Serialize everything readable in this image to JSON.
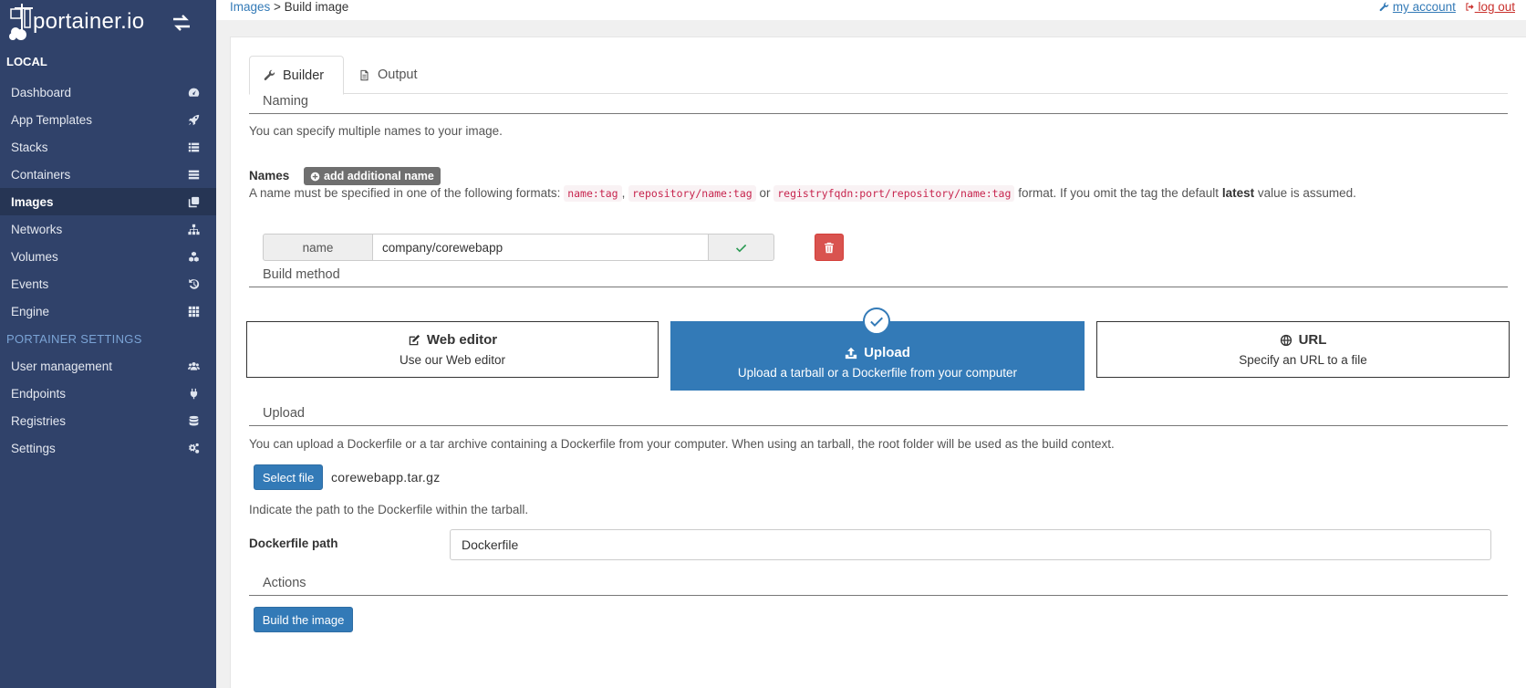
{
  "sidebar": {
    "brand": "portainer.io",
    "section_local": "LOCAL",
    "items": [
      {
        "label": "Dashboard",
        "icon": "tachometer-icon"
      },
      {
        "label": "App Templates",
        "icon": "rocket-icon"
      },
      {
        "label": "Stacks",
        "icon": "th-list-icon"
      },
      {
        "label": "Containers",
        "icon": "server-icon"
      },
      {
        "label": "Images",
        "icon": "clone-icon",
        "active": true
      },
      {
        "label": "Networks",
        "icon": "sitemap-icon"
      },
      {
        "label": "Volumes",
        "icon": "cubes-icon"
      },
      {
        "label": "Events",
        "icon": "history-icon"
      },
      {
        "label": "Engine",
        "icon": "th-icon"
      }
    ],
    "section_settings": "PORTAINER SETTINGS",
    "settings_items": [
      {
        "label": "User management",
        "icon": "users-icon"
      },
      {
        "label": "Endpoints",
        "icon": "plug-icon"
      },
      {
        "label": "Registries",
        "icon": "database-icon"
      },
      {
        "label": "Settings",
        "icon": "cogs-icon"
      }
    ]
  },
  "topbar": {
    "breadcrumb_link": "Images",
    "breadcrumb_current": "> Build image",
    "my_account": "my account",
    "log_out": "log out"
  },
  "tabs": {
    "builder": "Builder",
    "output": "Output"
  },
  "naming": {
    "title": "Naming",
    "help": "You can specify multiple names to your image.",
    "names_label": "Names",
    "add_button": "add additional name",
    "format_prefix": "A name must be specified in one of the following formats:",
    "format_1": "name:tag",
    "format_sep1": ",",
    "format_2": "repository/name:tag",
    "format_or": "or",
    "format_3": "registryfqdn:port/repository/name:tag",
    "format_suffix": "format. If you omit the tag the default",
    "format_latest": "latest",
    "format_end": "value is assumed.",
    "name_addon": "name",
    "name_value": "company/corewebapp"
  },
  "build_method": {
    "title": "Build method",
    "web_editor_title": "Web editor",
    "web_editor_desc": "Use our Web editor",
    "upload_title": "Upload",
    "upload_desc": "Upload a tarball or a Dockerfile from your computer",
    "url_title": "URL",
    "url_desc": "Specify an URL to a file",
    "selected": "upload"
  },
  "upload": {
    "title": "Upload",
    "help": "You can upload a Dockerfile or a tar archive containing a Dockerfile from your computer. When using an tarball, the root folder will be used as the build context.",
    "select_button": "Select file",
    "file_name": "corewebapp.tar.gz",
    "path_help": "Indicate the path to the Dockerfile within the tarball.",
    "path_label": "Dockerfile path",
    "path_value": "Dockerfile"
  },
  "actions": {
    "title": "Actions",
    "build_button": "Build the image"
  },
  "colors": {
    "sidebar": "#30426a",
    "primary": "#337ab7",
    "danger": "#d9534f",
    "success": "#2c9a54"
  }
}
